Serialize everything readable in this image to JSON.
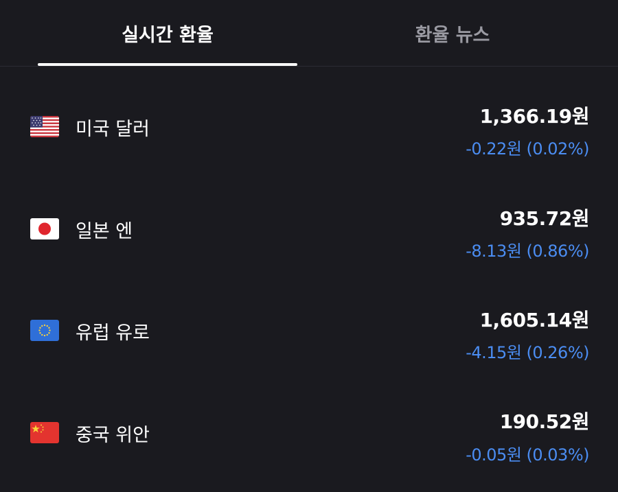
{
  "tabs": {
    "active": "실시간 환율",
    "inactive": "환율 뉴스"
  },
  "accent_color": "#4b8df2",
  "rates": [
    {
      "flag_icon": "us-flag-icon",
      "name": "미국 달러",
      "value": "1,366.19원",
      "change": "-0.22원 (0.02%)"
    },
    {
      "flag_icon": "japan-flag-icon",
      "name": "일본 엔",
      "value": "935.72원",
      "change": "-8.13원 (0.86%)"
    },
    {
      "flag_icon": "eu-flag-icon",
      "name": "유럽 유로",
      "value": "1,605.14원",
      "change": "-4.15원 (0.26%)"
    },
    {
      "flag_icon": "china-flag-icon",
      "name": "중국 위안",
      "value": "190.52원",
      "change": "-0.05원 (0.03%)"
    }
  ]
}
